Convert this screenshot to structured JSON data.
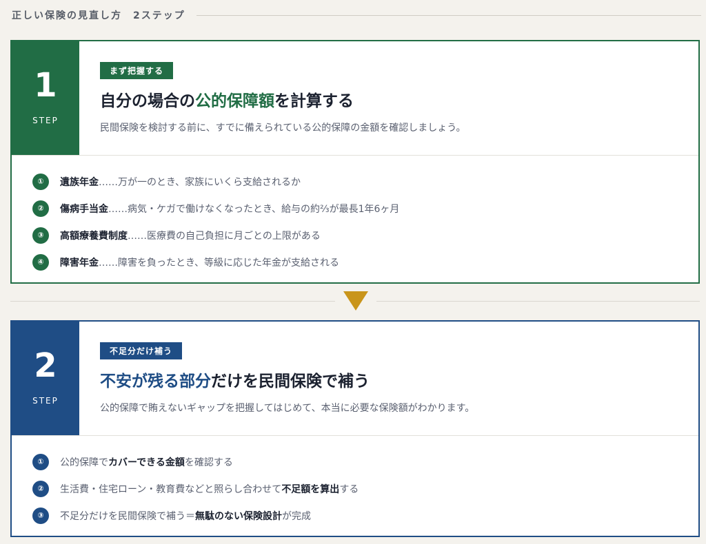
{
  "header": {
    "title": "正しい保険の見直し方　2ステップ"
  },
  "step1": {
    "number": "1",
    "step_word": "STEP",
    "tag": "まず把握する",
    "title_pre": "自分の場合の",
    "title_hl": "公的保障額",
    "title_post": "を計算する",
    "subtitle": "民間保険を検討する前に、すでに備えられている公的保障の金額を確認しましょう。",
    "items": [
      {
        "badge": "①",
        "bold": "遺族年金",
        "text": "……万が一のとき、家族にいくら支給されるか"
      },
      {
        "badge": "②",
        "bold": "傷病手当金",
        "text": "……病気・ケガで働けなくなったとき、給与の約⅔が最長1年6ヶ月"
      },
      {
        "badge": "③",
        "bold": "高額療養費制度",
        "text": "……医療費の自己負担に月ごとの上限がある"
      },
      {
        "badge": "④",
        "bold": "障害年金",
        "text": "……障害を負ったとき、等級に応じた年金が支給される"
      }
    ]
  },
  "step2": {
    "number": "2",
    "step_word": "STEP",
    "tag": "不足分だけ補う",
    "title_hl1": "不安が残る部分",
    "title_post": "だけを民間保険で補う",
    "subtitle": "公的保障で賄えないギャップを把握してはじめて、本当に必要な保険額がわかります。",
    "items": [
      {
        "badge": "①",
        "pre": "公的保障で",
        "bold": "カバーできる金額",
        "post": "を確認する"
      },
      {
        "badge": "②",
        "pre": "生活費・住宅ローン・教育費などと照らし合わせて",
        "bold": "不足額を算出",
        "post": "する"
      },
      {
        "badge": "③",
        "pre": "不足分だけを民間保険で補う＝",
        "bold": "無駄のない保険設計",
        "post": "が完成"
      }
    ]
  },
  "colors": {
    "green": "#216d45",
    "blue": "#1f4d85",
    "arrow": "#c9951b"
  },
  "icons": {
    "arrow": "down-triangle-icon"
  }
}
